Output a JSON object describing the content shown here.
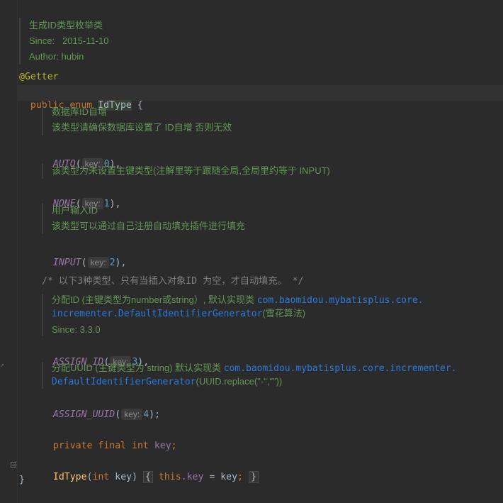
{
  "editor": {
    "class_doc": {
      "title": "生成ID类型枚举类",
      "since_label": "Since:",
      "since_value": "2015-11-10",
      "author": "Author: hubin"
    },
    "annotation": "@Getter",
    "decl": {
      "kw_public": "public",
      "kw_enum": "enum",
      "type_name": "IdType",
      "open_brace": "{"
    },
    "auto_doc": {
      "line1": "数据库ID自增",
      "line2": "该类型请确保数据库设置了 ID自增 否则无效"
    },
    "auto": {
      "name": "AUTO",
      "hint": "key:",
      "value": "0",
      "suffix": "),"
    },
    "none_doc": {
      "line1": "该类型为未设置主键类型(注解里等于跟随全局,全局里约等于 INPUT)"
    },
    "none": {
      "name": "NONE",
      "hint": "key:",
      "value": "1",
      "suffix": "),"
    },
    "input_doc": {
      "line1": "用户输入ID",
      "line2": "该类型可以通过自己注册自动填充插件进行填充"
    },
    "input": {
      "name": "INPUT",
      "hint": "key:",
      "value": "2",
      "suffix": "),"
    },
    "comment": "/* 以下3种类型、只有当插入对象ID 为空，才自动填充。 */",
    "assign_id_doc": {
      "prefix": "分配ID (主键类型为number或string）, 默认实现类",
      "class1": "com.baomidou.mybatisplus.core.",
      "class2": "incrementer.DefaultIdentifierGenerator",
      "suffix": "(雪花算法)",
      "since": "Since: 3.3.0"
    },
    "assign_id": {
      "name": "ASSIGN_ID",
      "hint": "key:",
      "value": "3",
      "suffix": "),"
    },
    "assign_uuid_doc": {
      "prefix": "分配UUID (主键类型为 string) 默认实现类",
      "class1": "com.baomidou.mybatisplus.core.incrementer.",
      "class2": "DefaultIdentifierGenerator",
      "suffix": "(UUID.replace(\"-\",\"\"))"
    },
    "assign_uuid": {
      "name": "ASSIGN_UUID",
      "hint": "key:",
      "value": "4",
      "suffix": ");"
    },
    "field_decl": {
      "kw": "private final int",
      "name": "key",
      "semi": ";"
    },
    "ctor": {
      "name": "IdType",
      "params_open": "(",
      "param_type": "int",
      "param_name": " key)",
      "body_open": "{",
      "this_kw": "this",
      "dot_field": ".key",
      "assign": " = key",
      "semi": ";",
      "body_close": "}"
    },
    "close_brace": "}"
  }
}
